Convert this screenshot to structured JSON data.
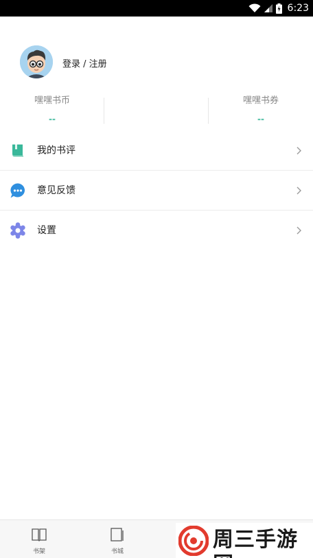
{
  "status_bar": {
    "time": "6:23"
  },
  "profile": {
    "login_text": "登录 / 注册"
  },
  "stats": [
    {
      "label": "嘿嘿书币",
      "value": "--"
    },
    {
      "label": "嘿嘿书券",
      "value": "--"
    }
  ],
  "menu": [
    {
      "label": "我的书评",
      "icon": "book-icon",
      "color": "#3ab89a"
    },
    {
      "label": "意见反馈",
      "icon": "chat-bubble-icon",
      "color": "#2f8fdf"
    },
    {
      "label": "设置",
      "icon": "gear-icon",
      "color": "#7d86e8"
    }
  ],
  "tabs": [
    {
      "label": "书架",
      "icon": "bookshelf-icon"
    },
    {
      "label": "书城",
      "icon": "bookstore-icon"
    }
  ],
  "watermark": {
    "text": "周三手游网"
  }
}
